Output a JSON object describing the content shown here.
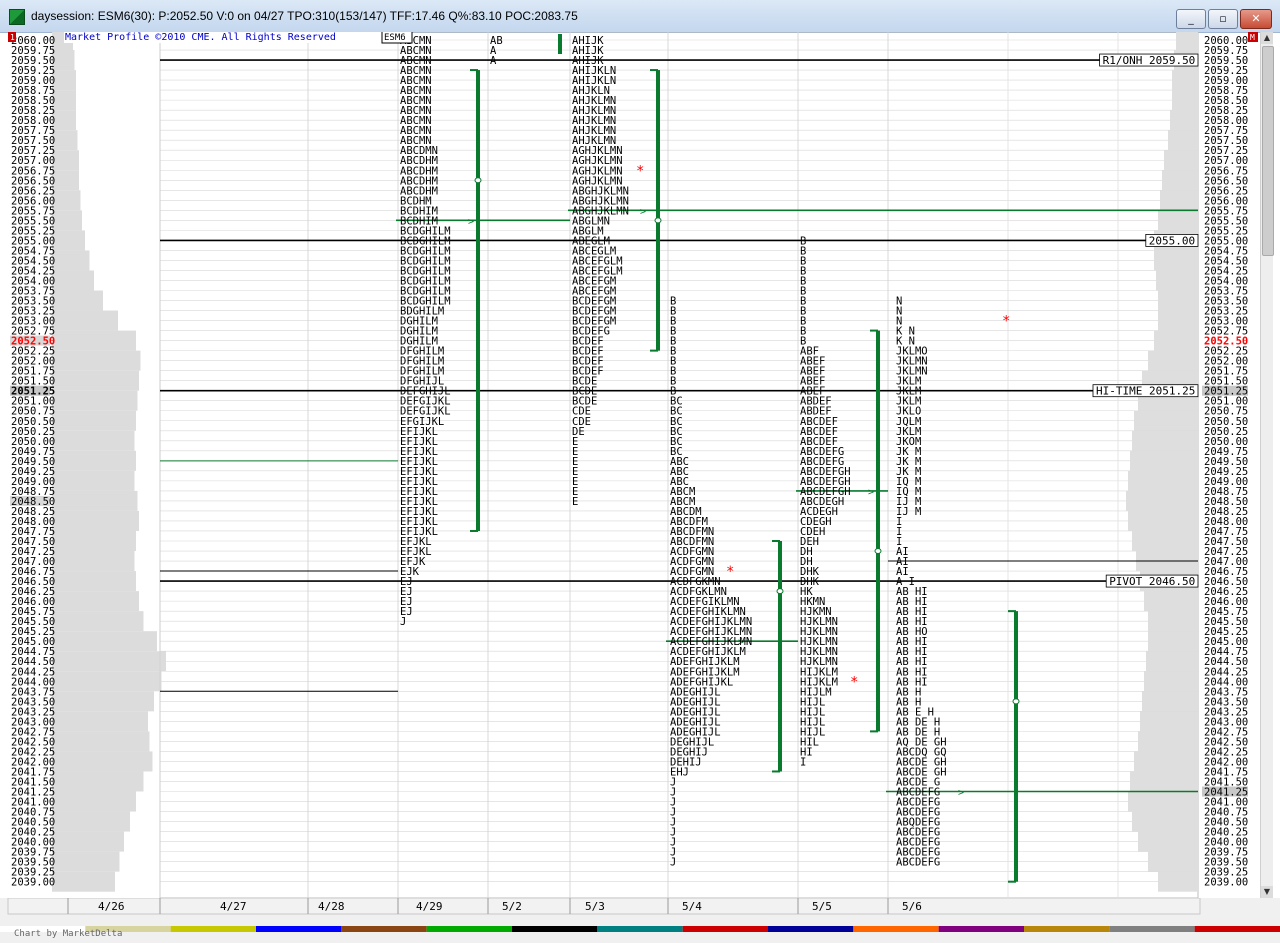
{
  "window": {
    "title": "daysession: ESM6(30): P:2052.50 V:0 on 04/27 TPO:310(153/147) TFF:17.46 Q%:83.10 POC:2083.75",
    "minimize": "_",
    "restore": "▫",
    "close": "✕"
  },
  "colors": {
    "value_area": "#0a7a2e",
    "highlight_price": "#ff0000",
    "hi_price_bg": "#c8c8c8",
    "grid": "#d7d7d7"
  },
  "chart": {
    "copyright": "Market Profile ©2010 CME. All Rights Reserved",
    "symbol": "ESM6",
    "left_badge": "1",
    "right_badge": "M",
    "credit": "Chart by MarketDelta",
    "current_price": "2052.50",
    "hi_time_price": "2051.25",
    "poc_right": "2041.25",
    "dates": [
      "4/26",
      "4/27",
      "4/28",
      "4/29",
      "5/2",
      "5/3",
      "5/4",
      "5/5",
      "5/6"
    ],
    "references": [
      {
        "label": "R1/ONH 2059.50",
        "price": 2059.5
      },
      {
        "label": "2055.00",
        "price": 2055.0
      },
      {
        "label": "HI-TIME 2051.25",
        "price": 2051.25
      },
      {
        "label": "PIVOT 2046.50",
        "price": 2046.5
      }
    ],
    "price_top": 2060.0,
    "price_bottom": 2039.0,
    "tick_step": 0.25
  },
  "chart_data": {
    "type": "table",
    "sessions": [
      {
        "date": "4/29",
        "top": 2060.0,
        "rows": [
          "ABCMN",
          "ABCMN",
          "ABCMN",
          "ABCMN",
          "ABCMN",
          "ABCMN",
          "ABCMN",
          "ABCMN",
          "ABCMN",
          "ABCMN",
          "ABCMN",
          "ABCDMN",
          "ABCDHM",
          "ABCDHM",
          "ABCDHM",
          "ABCDHM",
          "BCDHM",
          "BCDHIM",
          "BCDHIM",
          "BCDGHILM",
          "BCDGHILM",
          "BCDGHILM",
          "BCDGHILM",
          "BCDGHILM",
          "BCDGHILM",
          "BCDGHILM",
          "BCDGHILM",
          "BDGHILM",
          "DGHILM",
          "DGHILM",
          "DGHILM",
          "DFGHILM",
          "DFGHILM",
          "DFGHILM",
          "DFGHIJL",
          "DEFGHIJL",
          "DEFGIJKL",
          "DEFGIJKL",
          "EFGIJKL",
          "EFIJKL",
          "EFIJKL",
          "EFIJKL",
          "EFIJKL",
          "EFIJKL",
          "EFIJKL",
          "EFIJKL",
          "EFIJKL",
          "EFIJKL",
          "EFIJKL",
          "EFIJKL",
          "EFJKL",
          "EFJKL",
          "EFJK",
          "EJK",
          "EJ",
          "EJ",
          "EJ",
          "EJ",
          "J"
        ]
      },
      {
        "date": "5/2",
        "top": 2060.0,
        "rows": [
          "AB",
          "A",
          "A"
        ]
      },
      {
        "date": "5/3",
        "top": 2060.0,
        "rows": [
          "AHIJK",
          "AHIJK",
          "AHIJK",
          "AHIJKLN",
          "AHIJKLN",
          "AHJKLN",
          "AHJKLMN",
          "AHJKLMN",
          "AHJKLMN",
          "AHJKLMN",
          "AHJKLMN",
          "AGHJKLMN",
          "AGHJKLMN",
          "AGHJKLMN",
          "AGHJKLMN",
          "ABGHJKLMN",
          "ABGHJKLMN",
          "ABGHJKLMN",
          "ABGLMN",
          "ABGLM",
          "ABEGLM",
          "ABCEGLM",
          "ABCEFGLM",
          "ABCEFGLM",
          "ABCEFGM",
          "ABCEFGM",
          "BCDEFGM",
          "BCDEFGM",
          "BCDEFGM",
          "BCDEFG",
          "BCDEF",
          "BCDEF",
          "BCDEF",
          "BCDEF",
          "BCDE",
          "BCDE",
          "BCDE",
          "CDE",
          "CDE",
          "DE",
          "E",
          "E",
          "E",
          "E",
          "E",
          "E",
          "E"
        ]
      },
      {
        "date": "5/4",
        "top": 2053.5,
        "rows": [
          "B",
          "B",
          "B",
          "B",
          "B",
          "B",
          "B",
          "B",
          "B",
          "B",
          "BC",
          "BC",
          "BC",
          "BC",
          "BC",
          "BC",
          "ABC",
          "ABC",
          "ABC",
          "ABCM",
          "ABCM",
          "ABCDM",
          "ABCDFM",
          "ABCDFMN",
          "ABCDFMN",
          "ACDFGMN",
          "ACDFGMN",
          "ACDFGMN",
          "ACDFGKMN",
          "ACDFGKLMN",
          "ACDEFGIKLMN",
          "ACDEFGHIKLMN",
          "ACDEFGHIJKLMN",
          "ACDEFGHIJKLMN",
          "ACDEFGHIJKLMN",
          "ACDEFGHIJKLM",
          "ADEFGHIJKLM",
          "ADEFGHIJKLM",
          "ADEFGHIJKL",
          "ADEGHIJL",
          "ADEGHIJL",
          "ADEGHIJL",
          "ADEGHIJL",
          "ADEGHIJL",
          "DEGHIJL",
          "DEGHIJ",
          "DEHIJ",
          "EHJ",
          "J",
          "J",
          "J",
          "J",
          "J",
          "J",
          "J",
          "J",
          "J"
        ]
      },
      {
        "date": "5/5",
        "top": 2055.0,
        "rows": [
          "B",
          "B",
          "B",
          "B",
          "B",
          "B",
          "B",
          "B",
          "B",
          "B",
          "B",
          "ABF",
          "ABEF",
          "ABEF",
          "ABEF",
          "ABEF",
          "ABDEF",
          "ABDEF",
          "ABCDEF",
          "ABCDEF",
          "ABCDEF",
          "ABCDEFG",
          "ABCDEFG",
          "ABCDEFGH",
          "ABCDEFGH",
          "ABCDEFGH",
          "ABCDEGH",
          "ACDEGH",
          "CDEGH",
          "CDEH",
          "DEH",
          "DH",
          "DH",
          "DHK",
          "DHK",
          "HK",
          "HKMN",
          "HJKMN",
          "HJKLMN",
          "HJKLMN",
          "HJKLMN",
          "HJKLMN",
          "HJKLMN",
          "HIJKLM",
          "HIJKLM",
          "HIJLM",
          "HIJL",
          "HIJL",
          "HIJL",
          "HIJL",
          "HIL",
          "HI",
          "I"
        ]
      },
      {
        "date": "5/6",
        "top": 2053.5,
        "rows": [
          "N",
          "N",
          "N",
          "K N",
          "K N",
          "JKLMO",
          "JKLMN",
          "JKLMN",
          "JKLM",
          "JKLM",
          "JKLM",
          "JKLO",
          "JQLM",
          "JKLM",
          "JKOM",
          "JK M",
          "JK M",
          "JK M",
          "IQ M",
          "IQ M",
          "IJ M",
          "IJ M",
          "I",
          "I",
          "I",
          "AI",
          "AI",
          "AI",
          "A I",
          "AB HI",
          "AB HI",
          "AB HI",
          "AB HI",
          "AB HO",
          "AB HI",
          "AB HI",
          "AB HI",
          "AB HI",
          "AB HI",
          "AB H",
          "AB H",
          "AB E H",
          "AB DE H",
          "AB DE H",
          "AQ DE GH",
          "ABCDQ GQ",
          "ABCDE GH",
          "ABCDE GH",
          "ABCDE G",
          "ABCDEFG",
          "ABCDEFG",
          "ABCDEFG",
          "ABQDEFG",
          "ABCDEFG",
          "ABCDEFG",
          "ABCDEFG",
          "ABCDEFG"
        ]
      }
    ],
    "volume_profile_left": [
      {
        "price": 2060.0,
        "width": 28
      },
      {
        "price": 2059.5,
        "width": 30
      },
      {
        "price": 2059.0,
        "width": 32
      },
      {
        "price": 2058.5,
        "width": 32
      },
      {
        "price": 2058.0,
        "width": 32
      },
      {
        "price": 2057.5,
        "width": 34
      },
      {
        "price": 2057.0,
        "width": 36
      },
      {
        "price": 2056.5,
        "width": 36
      },
      {
        "price": 2056.0,
        "width": 38
      },
      {
        "price": 2055.5,
        "width": 40
      },
      {
        "price": 2055.0,
        "width": 44
      },
      {
        "price": 2054.5,
        "width": 50
      },
      {
        "price": 2054.0,
        "width": 56
      },
      {
        "price": 2053.5,
        "width": 68
      },
      {
        "price": 2053.0,
        "width": 88
      },
      {
        "price": 2052.5,
        "width": 112
      },
      {
        "price": 2052.0,
        "width": 118
      },
      {
        "price": 2051.5,
        "width": 116
      },
      {
        "price": 2051.0,
        "width": 114
      },
      {
        "price": 2050.5,
        "width": 112
      },
      {
        "price": 2050.0,
        "width": 110
      },
      {
        "price": 2049.5,
        "width": 112
      },
      {
        "price": 2049.0,
        "width": 110
      },
      {
        "price": 2048.5,
        "width": 114
      },
      {
        "price": 2048.0,
        "width": 116
      },
      {
        "price": 2047.5,
        "width": 112
      },
      {
        "price": 2047.0,
        "width": 110
      },
      {
        "price": 2046.5,
        "width": 112
      },
      {
        "price": 2046.0,
        "width": 116
      },
      {
        "price": 2045.5,
        "width": 122
      },
      {
        "price": 2045.0,
        "width": 140
      },
      {
        "price": 2044.5,
        "width": 152
      },
      {
        "price": 2044.0,
        "width": 146
      },
      {
        "price": 2043.5,
        "width": 136
      },
      {
        "price": 2043.0,
        "width": 128
      },
      {
        "price": 2042.5,
        "width": 130
      },
      {
        "price": 2042.0,
        "width": 134
      },
      {
        "price": 2041.5,
        "width": 122
      },
      {
        "price": 2041.0,
        "width": 112
      },
      {
        "price": 2040.5,
        "width": 104
      },
      {
        "price": 2040.0,
        "width": 96
      },
      {
        "price": 2039.5,
        "width": 90
      },
      {
        "price": 2039.0,
        "width": 84
      }
    ],
    "volume_profile_right": [
      {
        "price": 2060.0,
        "width": 22
      },
      {
        "price": 2059.5,
        "width": 24
      },
      {
        "price": 2059.0,
        "width": 26
      },
      {
        "price": 2058.5,
        "width": 26
      },
      {
        "price": 2058.0,
        "width": 28
      },
      {
        "price": 2057.5,
        "width": 30
      },
      {
        "price": 2057.0,
        "width": 34
      },
      {
        "price": 2056.5,
        "width": 36
      },
      {
        "price": 2056.0,
        "width": 38
      },
      {
        "price": 2055.5,
        "width": 40
      },
      {
        "price": 2055.0,
        "width": 44
      },
      {
        "price": 2054.5,
        "width": 44
      },
      {
        "price": 2054.0,
        "width": 42
      },
      {
        "price": 2053.5,
        "width": 40
      },
      {
        "price": 2053.0,
        "width": 40
      },
      {
        "price": 2052.5,
        "width": 44
      },
      {
        "price": 2052.0,
        "width": 50
      },
      {
        "price": 2051.5,
        "width": 56
      },
      {
        "price": 2051.0,
        "width": 60
      },
      {
        "price": 2050.5,
        "width": 64
      },
      {
        "price": 2050.0,
        "width": 66
      },
      {
        "price": 2049.5,
        "width": 68
      },
      {
        "price": 2049.0,
        "width": 70
      },
      {
        "price": 2048.5,
        "width": 72
      },
      {
        "price": 2048.0,
        "width": 70
      },
      {
        "price": 2047.5,
        "width": 66
      },
      {
        "price": 2047.0,
        "width": 62
      },
      {
        "price": 2046.5,
        "width": 58
      },
      {
        "price": 2046.0,
        "width": 54
      },
      {
        "price": 2045.5,
        "width": 50
      },
      {
        "price": 2045.0,
        "width": 50
      },
      {
        "price": 2044.5,
        "width": 52
      },
      {
        "price": 2044.0,
        "width": 54
      },
      {
        "price": 2043.5,
        "width": 56
      },
      {
        "price": 2043.0,
        "width": 58
      },
      {
        "price": 2042.5,
        "width": 60
      },
      {
        "price": 2042.0,
        "width": 64
      },
      {
        "price": 2041.5,
        "width": 68
      },
      {
        "price": 2041.0,
        "width": 70
      },
      {
        "price": 2040.5,
        "width": 66
      },
      {
        "price": 2040.0,
        "width": 60
      },
      {
        "price": 2039.5,
        "width": 50
      },
      {
        "price": 2039.0,
        "width": 40
      }
    ],
    "value_areas": [
      {
        "date": "4/29",
        "high": 2059.25,
        "low": 2047.75,
        "poc": 2056.5
      },
      {
        "date": "5/3",
        "high": 2059.25,
        "low": 2052.25,
        "poc": 2055.5
      },
      {
        "date": "5/4",
        "high": 2047.5,
        "low": 2041.75,
        "poc": 2046.25
      },
      {
        "date": "5/5",
        "high": 2052.75,
        "low": 2042.75,
        "poc": 2047.25
      },
      {
        "date": "5/6",
        "high": 2045.75,
        "low": 2039.0,
        "poc": 2043.5
      }
    ],
    "poc_lines": [
      {
        "date": "4/29",
        "price": 2055.5,
        "to": "5/3"
      },
      {
        "date": "5/3",
        "price": 2055.75,
        "to": "end"
      },
      {
        "date": "5/4",
        "price": 2045.0,
        "to": "5/5"
      },
      {
        "date": "5/5",
        "price": 2048.75,
        "to": "5/6"
      },
      {
        "date": "5/6",
        "price": 2041.25,
        "to": "end"
      }
    ],
    "asterisks": [
      {
        "date": "5/3",
        "price": 2056.75
      },
      {
        "date": "5/4",
        "price": 2046.75
      },
      {
        "date": "5/5",
        "price": 2044.0
      },
      {
        "date": "5/6",
        "price": 2053.0
      }
    ]
  }
}
